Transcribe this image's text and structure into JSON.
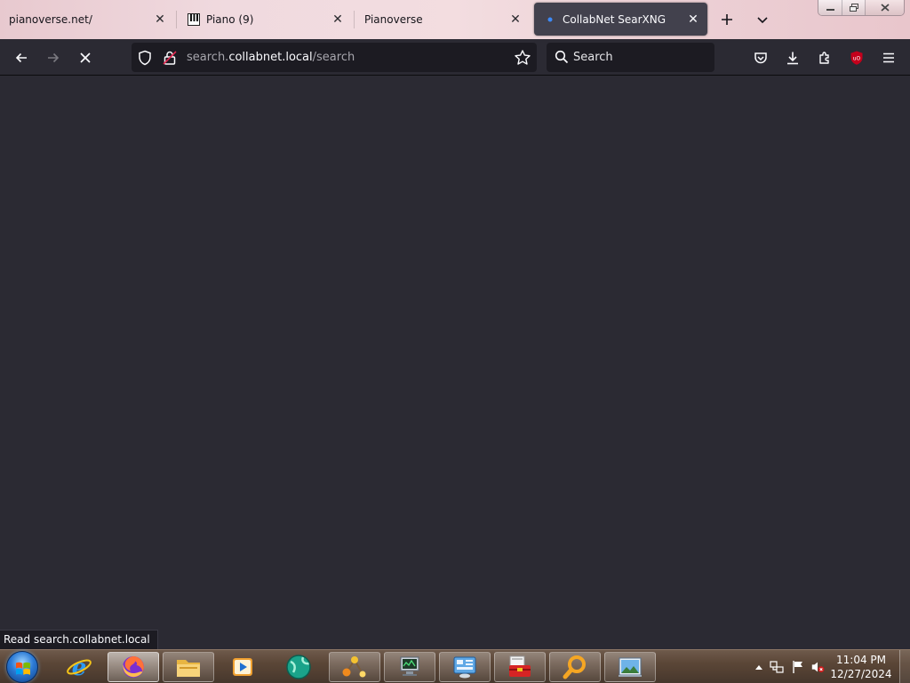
{
  "tabs": [
    {
      "title": "pianoverse.net/",
      "favicon": "none"
    },
    {
      "title": "Piano (9)",
      "favicon": "piano-keys-icon"
    },
    {
      "title": "Pianoverse",
      "favicon": "none"
    },
    {
      "title": "CollabNet SearXNG",
      "favicon": "searxng-dot-icon",
      "active": true
    }
  ],
  "urlbar": {
    "url_prefix": "search.",
    "url_host": "collabnet.local",
    "url_path": "/search"
  },
  "searchbar": {
    "placeholder": "Search"
  },
  "status_text": "Read search.collabnet.local",
  "clock": {
    "time": "11:04 PM",
    "date": "12/27/2024"
  },
  "colors": {
    "toolbar": "#2b2a33",
    "field": "#1c1b22",
    "active_tab": "#42414d",
    "tab_strip": "#f0dadf",
    "ublock": "#c4001c"
  },
  "icons": {
    "nav": [
      "back-arrow-icon",
      "forward-arrow-icon",
      "stop-loading-icon"
    ],
    "toolbar": [
      "pocket-icon",
      "download-icon",
      "extensions-icon",
      "ublock-origin-icon",
      "hamburger-menu-icon"
    ],
    "taskbar": [
      "windows-start-orb-icon",
      "internet-explorer-icon",
      "firefox-icon",
      "file-explorer-icon",
      "media-player-icon",
      "globe-app-icon",
      "network-graph-icon",
      "monitor-app-icon",
      "control-panel-icon",
      "toolbox-icon",
      "magnifier-search-icon",
      "picture-viewer-icon"
    ]
  }
}
